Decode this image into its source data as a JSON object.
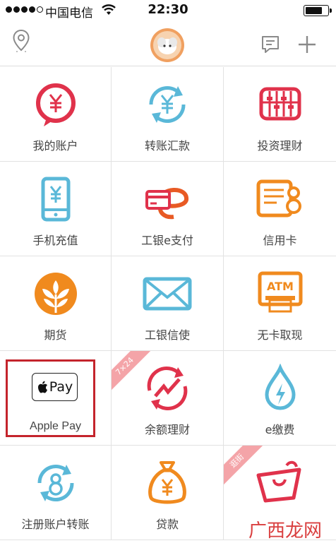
{
  "status_bar": {
    "carrier": "中国电信",
    "time": "22:30"
  },
  "colors": {
    "red": "#e0324b",
    "blue": "#5ab8d8",
    "orange": "#f08a1e",
    "highlight": "#c4242c",
    "ribbon": "#f4a4a8"
  },
  "grid": {
    "items": [
      {
        "label": "我的账户",
        "icon": "account-icon"
      },
      {
        "label": "转账汇款",
        "icon": "transfer-icon"
      },
      {
        "label": "投资理财",
        "icon": "invest-icon"
      },
      {
        "label": "手机充值",
        "icon": "phone-topup-icon"
      },
      {
        "label": "工银e支付",
        "icon": "e-pay-icon"
      },
      {
        "label": "信用卡",
        "icon": "credit-card-icon"
      },
      {
        "label": "期货",
        "icon": "futures-icon"
      },
      {
        "label": "工银信使",
        "icon": "messenger-icon"
      },
      {
        "label": "无卡取现",
        "icon": "atm-icon"
      },
      {
        "label": "Apple Pay",
        "icon": "apple-pay-icon"
      },
      {
        "label": "余额理财",
        "icon": "balance-invest-icon",
        "ribbon": "7×24"
      },
      {
        "label": "e缴费",
        "icon": "e-payment-icon"
      },
      {
        "label": "注册账户转账",
        "icon": "register-transfer-icon"
      },
      {
        "label": "贷款",
        "icon": "loan-icon"
      },
      {
        "label": "",
        "icon": "shopping-icon",
        "ribbon": "逛街"
      }
    ]
  },
  "apple_pay_badge": "Pay",
  "watermark": "广西龙网"
}
